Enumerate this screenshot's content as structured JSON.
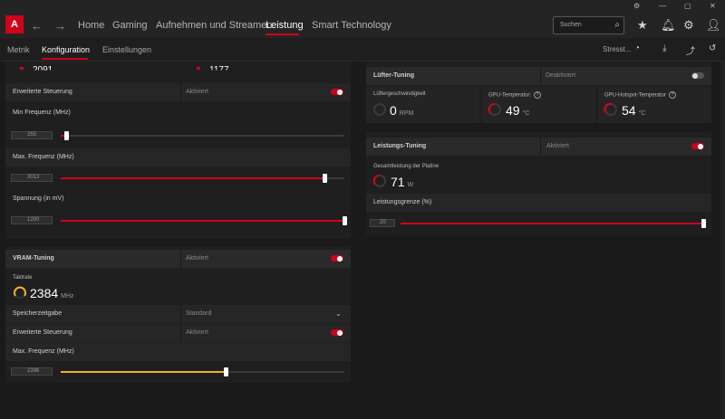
{
  "app": {
    "logo": "A"
  },
  "window": {
    "controls": [
      "⚙",
      "—",
      "▢",
      "✕"
    ]
  },
  "nav": {
    "back": "←",
    "forward": "→",
    "tabs": [
      "Home",
      "Gaming",
      "Aufnehmen und Streamen",
      "Leistung",
      "Smart Technology"
    ],
    "active": "Leistung"
  },
  "search": {
    "placeholder": "Suchen",
    "icon": "search-icon"
  },
  "subnav": {
    "tabs": [
      "Metrik",
      "Konfiguration",
      "Einstellungen"
    ],
    "active": "Konfiguration",
    "right_label": "Stresst..."
  },
  "left": {
    "clipped_values": [
      "2091",
      "1177"
    ],
    "adv_control": {
      "label": "Erweiterte Steuerung",
      "state": "Aktiviert"
    },
    "min_freq": {
      "label": "Min Frequenz (MHz)",
      "value": "255",
      "percent": 2
    },
    "max_freq": {
      "label": "Max. Frequenz (MHz)",
      "value": "3013",
      "percent": 93
    },
    "voltage": {
      "label": "Spannung (in mV)",
      "value": "1200",
      "percent": 100
    },
    "vram": {
      "title": "VRAM-Tuning",
      "state": "Aktiviert",
      "clock_label": "Taktrate",
      "clock_value": "2384",
      "clock_unit": "MHz",
      "timing_label": "Speicherzeitgabe",
      "timing_value": "Standard",
      "adv_label": "Erweiterte Steuerung",
      "adv_state": "Aktiviert",
      "max_freq_label": "Max. Frequenz (MHz)",
      "max_freq_value": "2396",
      "percent": 58
    }
  },
  "right": {
    "fan": {
      "title": "Lüfter-Tuning",
      "state": "Deaktiviert",
      "speed_label": "Lüftergeschwindigkeit",
      "speed_value": "0",
      "speed_unit": "RPM",
      "temp_label": "GPU-Temperatur:",
      "temp_value": "49",
      "temp_unit": "°C",
      "hotspot_label": "GPU-Hotspot-Temperatur",
      "hotspot_value": "54",
      "hotspot_unit": "°C",
      "help": "?"
    },
    "power": {
      "title": "Leistungs-Tuning",
      "state": "Aktiviert",
      "board_label": "Gesamtleistung der Platine",
      "board_value": "71",
      "board_unit": "W",
      "limit_label": "Leistungsgrenze (%)",
      "limit_value": "20",
      "percent": 100
    }
  },
  "colors": {
    "accent": "#d0021b",
    "vram_accent": "#f0b323",
    "bg": "#1a1a1a"
  }
}
